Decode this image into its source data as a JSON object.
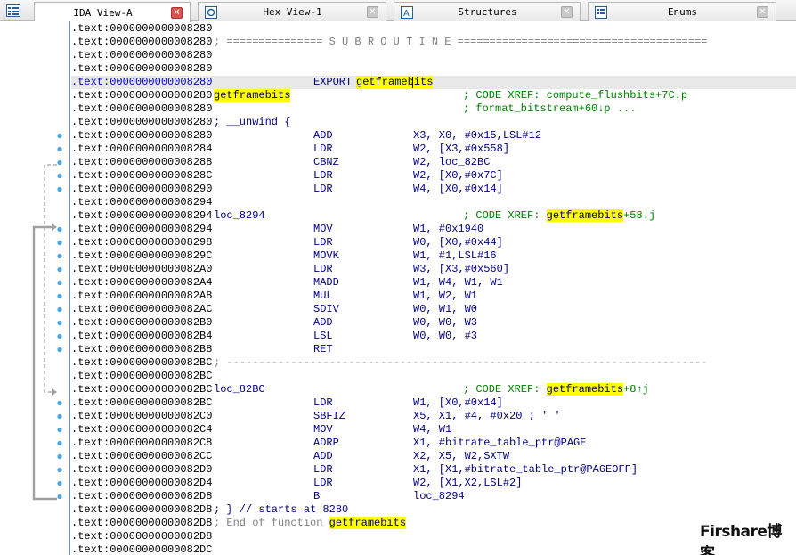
{
  "tabs": [
    {
      "label": "IDA View-A",
      "icon": "ida-view-icon",
      "active": true
    },
    {
      "label": "Hex View-1",
      "icon": "hex-view-icon",
      "active": false
    },
    {
      "label": "Structures",
      "icon": "structures-icon",
      "active": false
    },
    {
      "label": "Enums",
      "icon": "enums-icon",
      "active": false
    }
  ],
  "colors": {
    "highlight": "#ffff00",
    "instruction": "#000080",
    "comment": "#008000",
    "separator": "#808080",
    "flow_arrow": "#a0a0a0",
    "breakpoint_dot": "#4da6e0",
    "close_active": "#d9534f"
  },
  "rows": [
    {
      "addr": ".text:0000000000008280"
    },
    {
      "addr": ".text:0000000000008280",
      "sep": "; =============== S U B R O U T I N E ======================================="
    },
    {
      "addr": ".text:0000000000008280"
    },
    {
      "addr": ".text:0000000000008280"
    },
    {
      "addr": ".text:0000000000008280",
      "mnem": "EXPORT",
      "oper_hl": "getframebits",
      "current": true
    },
    {
      "addr": ".text:0000000000008280",
      "label_hl": "getframebits",
      "cmt": "; CODE XREF: compute_flushbits+7C↓p"
    },
    {
      "addr": ".text:0000000000008280",
      "cmt": "; format_bitstream+60↓p ..."
    },
    {
      "addr": ".text:0000000000008280",
      "wide": "; __unwind {"
    },
    {
      "addr": ".text:0000000000008280",
      "mnem": "ADD",
      "oper": "X3, X0, #0x15,LSL#12",
      "dot": true
    },
    {
      "addr": ".text:0000000000008284",
      "mnem": "LDR",
      "oper": "W2, [X3,#0x558]",
      "dot": true
    },
    {
      "addr": ".text:0000000000008288",
      "mnem": "CBNZ",
      "oper": "W2, loc_82BC",
      "dot": true
    },
    {
      "addr": ".text:000000000000828C",
      "mnem": "LDR",
      "oper": "W2, [X0,#0x7C]",
      "dot": true
    },
    {
      "addr": ".text:0000000000008290",
      "mnem": "LDR",
      "oper": "W4, [X0,#0x14]",
      "dot": true
    },
    {
      "addr": ".text:0000000000008294"
    },
    {
      "addr": ".text:0000000000008294",
      "label": "loc_8294",
      "cmt": "; CODE XREF: ",
      "cmt_hl": "getframebits",
      "cmt_tail": "+58↓j"
    },
    {
      "addr": ".text:0000000000008294",
      "mnem": "MOV",
      "oper": "W1, #0x1940",
      "dot": true
    },
    {
      "addr": ".text:0000000000008298",
      "mnem": "LDR",
      "oper": "W0, [X0,#0x44]",
      "dot": true
    },
    {
      "addr": ".text:000000000000829C",
      "mnem": "MOVK",
      "oper": "W1, #1,LSL#16",
      "dot": true
    },
    {
      "addr": ".text:00000000000082A0",
      "mnem": "LDR",
      "oper": "W3, [X3,#0x560]",
      "dot": true
    },
    {
      "addr": ".text:00000000000082A4",
      "mnem": "MADD",
      "oper": "W1, W4, W1, W1",
      "dot": true
    },
    {
      "addr": ".text:00000000000082A8",
      "mnem": "MUL",
      "oper": "W1, W2, W1",
      "dot": true
    },
    {
      "addr": ".text:00000000000082AC",
      "mnem": "SDIV",
      "oper": "W0, W1, W0",
      "dot": true
    },
    {
      "addr": ".text:00000000000082B0",
      "mnem": "ADD",
      "oper": "W0, W0, W3",
      "dot": true
    },
    {
      "addr": ".text:00000000000082B4",
      "mnem": "LSL",
      "oper": "W0, W0, #3",
      "dot": true
    },
    {
      "addr": ".text:00000000000082B8",
      "mnem": "RET",
      "dot": true
    },
    {
      "addr": ".text:00000000000082BC",
      "sep": "; ---------------------------------------------------------------------------"
    },
    {
      "addr": ".text:00000000000082BC"
    },
    {
      "addr": ".text:00000000000082BC",
      "label": "loc_82BC",
      "cmt": "; CODE XREF: ",
      "cmt_hl": "getframebits",
      "cmt_tail": "+8↑j"
    },
    {
      "addr": ".text:00000000000082BC",
      "mnem": "LDR",
      "oper": "W1, [X0,#0x14]",
      "dot": true
    },
    {
      "addr": ".text:00000000000082C0",
      "mnem": "SBFIZ",
      "oper": "X5, X1, #4, #0x20 ; ' '",
      "dot": true
    },
    {
      "addr": ".text:00000000000082C4",
      "mnem": "MOV",
      "oper": "W4, W1",
      "dot": true
    },
    {
      "addr": ".text:00000000000082C8",
      "mnem": "ADRP",
      "oper": "X1, #bitrate_table_ptr@PAGE",
      "dot": true
    },
    {
      "addr": ".text:00000000000082CC",
      "mnem": "ADD",
      "oper": "X2, X5, W2,SXTW",
      "dot": true
    },
    {
      "addr": ".text:00000000000082D0",
      "mnem": "LDR",
      "oper": "X1, [X1,#bitrate_table_ptr@PAGEOFF]",
      "dot": true
    },
    {
      "addr": ".text:00000000000082D4",
      "mnem": "LDR",
      "oper": "W2, [X1,X2,LSL#2]",
      "dot": true
    },
    {
      "addr": ".text:00000000000082D8",
      "mnem": "B",
      "oper": "loc_8294",
      "dot": true
    },
    {
      "addr": ".text:00000000000082D8",
      "wide": "; } // starts at 8280"
    },
    {
      "addr": ".text:00000000000082D8",
      "grey": "; End of function ",
      "grey_hl": "getframebits"
    },
    {
      "addr": ".text:00000000000082D8"
    },
    {
      "addr": ".text:00000000000082DC"
    }
  ],
  "watermark": "Firshare博客"
}
